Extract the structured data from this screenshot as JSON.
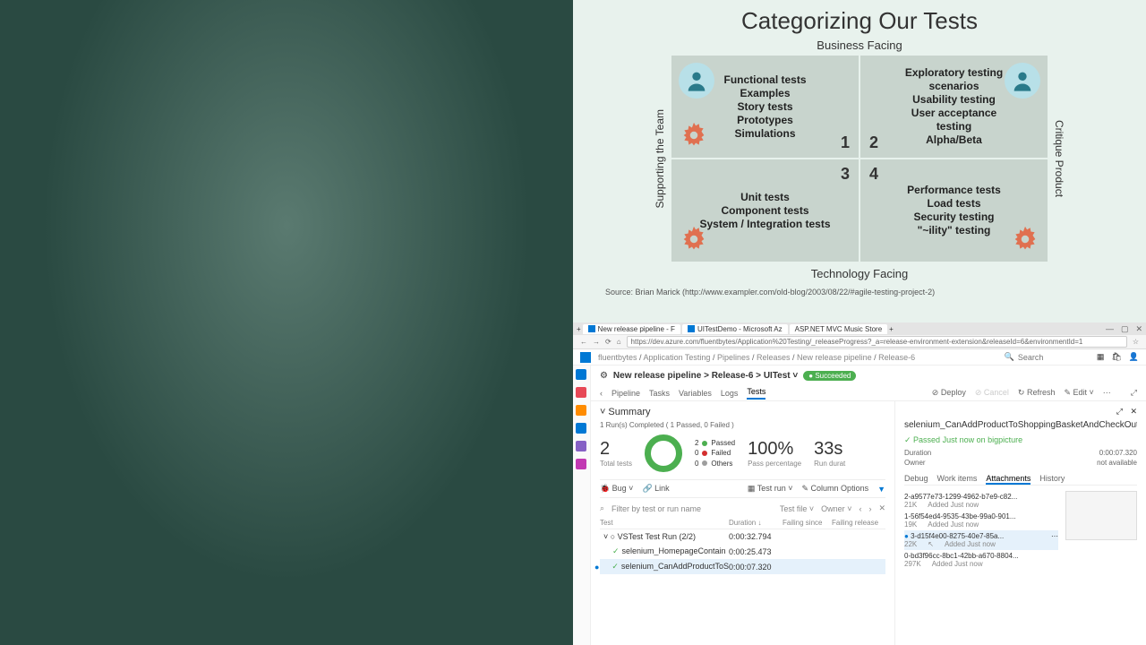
{
  "slide": {
    "title": "Categorizing Our Tests",
    "axis_top": "Business Facing",
    "axis_bottom": "Technology Facing",
    "axis_left": "Supporting the Team",
    "axis_right": "Critique Product",
    "q1": {
      "num": "1",
      "lines": [
        "Functional tests",
        "Examples",
        "Story tests",
        "Prototypes",
        "Simulations"
      ]
    },
    "q2": {
      "num": "2",
      "lines": [
        "Exploratory testing",
        "scenarios",
        "Usability testing",
        "User acceptance",
        "testing",
        "Alpha/Beta"
      ]
    },
    "q3": {
      "num": "3",
      "lines": [
        "Unit tests",
        "Component tests",
        "System / Integration tests"
      ]
    },
    "q4": {
      "num": "4",
      "lines": [
        "Performance tests",
        "Load tests",
        "Security testing",
        "\"~ility\" testing"
      ]
    },
    "source": "Source: Brian Marick (http://www.exampler.com/old-blog/2003/08/22/#agile-testing-project-2)"
  },
  "browser": {
    "tabs": [
      {
        "label": "New release pipeline - F"
      },
      {
        "label": "UITestDemo - Microsoft Az"
      },
      {
        "label": "ASP.NET MVC Music Store"
      }
    ],
    "url": "https://dev.azure.com/fluentbytes/Application%20Testing/_releaseProgress?_a=release-environment-extension&releaseId=6&environmentId=1",
    "breadcrumb": [
      "fluentbytes",
      "Application Testing",
      "Pipelines",
      "Releases",
      "New release pipeline",
      "Release-6"
    ],
    "search_placeholder": "Search"
  },
  "pipeline": {
    "path": [
      "New release pipeline",
      "Release-6",
      "UITest"
    ],
    "status": "Succeeded",
    "tabs": [
      "Pipeline",
      "Tasks",
      "Variables",
      "Logs",
      "Tests"
    ],
    "active_tab": "Tests",
    "actions": {
      "deploy": "Deploy",
      "cancel": "Cancel",
      "refresh": "Refresh",
      "edit": "Edit"
    }
  },
  "summary": {
    "title": "Summary",
    "subtitle": "1 Run(s) Completed ( 1 Passed, 0 Failed )",
    "total": {
      "value": "2",
      "label": "Total tests"
    },
    "legend": [
      {
        "label": "Passed",
        "value": "2",
        "color": "#4caf50"
      },
      {
        "label": "Failed",
        "value": "0",
        "color": "#d32f2f"
      },
      {
        "label": "Others",
        "value": "0",
        "color": "#9e9e9e"
      }
    ],
    "pass_pct": {
      "value": "100%",
      "label": "Pass percentage"
    },
    "duration": {
      "value": "33s",
      "label": "Run durat"
    }
  },
  "toolbar": {
    "bug": "Bug",
    "link": "Link",
    "testrun": "Test run",
    "columns": "Column Options"
  },
  "filter": {
    "placeholder": "Filter by test or run name",
    "group1": "Test file",
    "group2": "Owner"
  },
  "table": {
    "headers": {
      "test": "Test",
      "duration": "Duration",
      "failing_since": "Failing since",
      "failing_release": "Failing release"
    },
    "rows": [
      {
        "name": "VSTest Test Run (2/2)",
        "duration": "0:00:32.794",
        "indent": 0,
        "expandable": true
      },
      {
        "name": "selenium_HomepageContain",
        "duration": "0:00:25.473",
        "indent": 1,
        "pass": true
      },
      {
        "name": "selenium_CanAddProductToS",
        "duration": "0:00:07.320",
        "indent": 1,
        "pass": true,
        "selected": true
      }
    ]
  },
  "details": {
    "title": "selenium_CanAddProductToShoppingBasketAndCheckOutSelenium",
    "status": "Passed Just now on bigpicture",
    "meta": [
      {
        "label": "Duration",
        "value": "0:00:07.320"
      },
      {
        "label": "Owner",
        "value": "not available"
      }
    ],
    "tabs": [
      "Debug",
      "Work items",
      "Attachments",
      "History"
    ],
    "active_tab": "Attachments",
    "attachments": [
      {
        "name": "2-a9577e73-1299-4962-b7e9-c82...",
        "size": "21K",
        "added": "Added Just now"
      },
      {
        "name": "1-56f54ed4-9535-43be-99a0-901...",
        "size": "19K",
        "added": "Added Just now"
      },
      {
        "name": "3-d15f4e00-8275-40e7-85a...",
        "size": "22K",
        "added": "Added Just now",
        "selected": true
      },
      {
        "name": "0-bd3f96cc-8bc1-42bb-a670-8804...",
        "size": "297K",
        "added": "Added Just now"
      }
    ]
  }
}
